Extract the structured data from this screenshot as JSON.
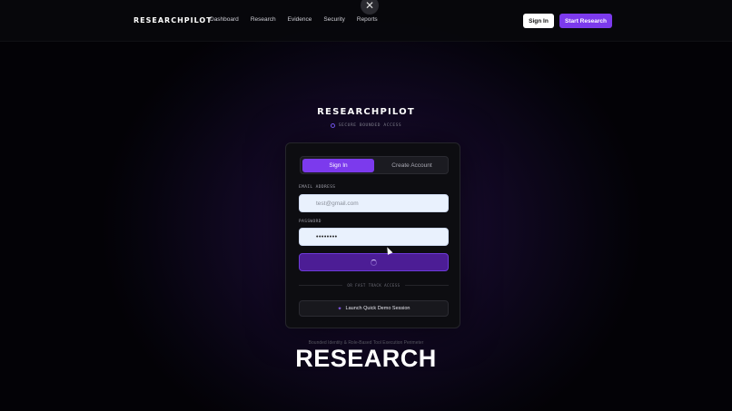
{
  "nav": {
    "brand": "RESEARCHPILOT",
    "links": [
      "Dashboard",
      "Research",
      "Evidence",
      "Security",
      "Reports"
    ],
    "sign_in": "Sign In",
    "start": "Start Research",
    "close_icon": "✕"
  },
  "hero": {
    "title": "RESEARCHPILOT",
    "subtitle": "SECURE BOUNDED ACCESS"
  },
  "auth": {
    "tab_signin": "Sign In",
    "tab_create": "Create Account",
    "email_label": "EMAIL ADDRESS",
    "email_value": "test@gmail.com",
    "password_label": "PASSWORD",
    "password_value": "••••••••",
    "divider": "OR FAST TRACK ACCESS",
    "demo_label": "Launch Quick Demo Session",
    "demo_icon": "✦"
  },
  "footer": {
    "tagline": "Bounded Identity & Role-Based Tool Execution Perimeter",
    "big_word": "RESEARCH"
  },
  "colors": {
    "accent": "#7c3aed",
    "background": "#030206"
  }
}
